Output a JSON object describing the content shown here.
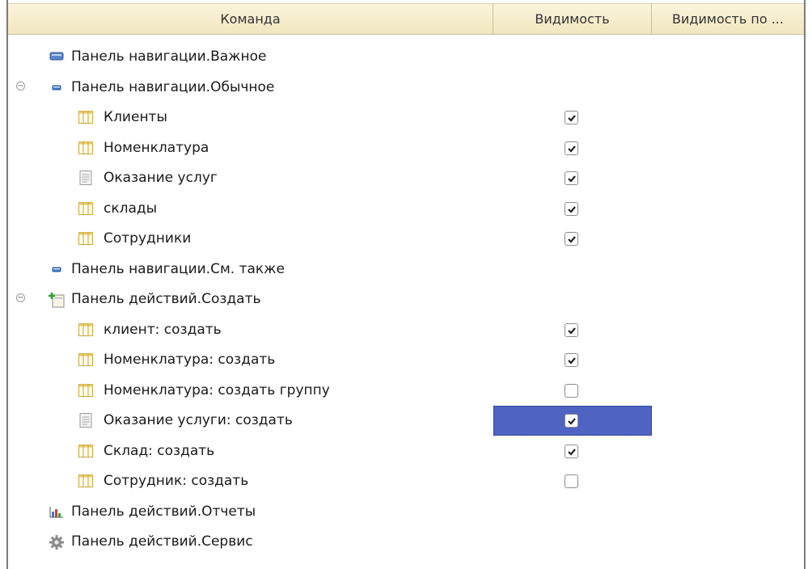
{
  "columns": {
    "command": "Команда",
    "visibility": "Видимость",
    "visibility_by": "Видимость по ..."
  },
  "rows": [
    {
      "label": "Панель навигации.Важное",
      "icon": "nav-panel-important-icon",
      "level": 0,
      "toggle": false,
      "checkbox": null
    },
    {
      "label": "Панель навигации.Обычное",
      "icon": "nav-panel-normal-icon",
      "level": 0,
      "toggle": true,
      "checkbox": null
    },
    {
      "label": "Клиенты",
      "icon": "catalog-icon",
      "level": 1,
      "toggle": false,
      "checkbox": true
    },
    {
      "label": "Номенклатура",
      "icon": "catalog-icon",
      "level": 1,
      "toggle": false,
      "checkbox": true
    },
    {
      "label": "Оказание услуг",
      "icon": "document-icon",
      "level": 1,
      "toggle": false,
      "checkbox": true
    },
    {
      "label": "склады",
      "icon": "catalog-icon",
      "level": 1,
      "toggle": false,
      "checkbox": true
    },
    {
      "label": "Сотрудники",
      "icon": "catalog-icon",
      "level": 1,
      "toggle": false,
      "checkbox": true
    },
    {
      "label": "Панель навигации.См. также",
      "icon": "nav-panel-see-also-icon",
      "level": 0,
      "toggle": false,
      "checkbox": null
    },
    {
      "label": "Панель действий.Создать",
      "icon": "create-document-icon",
      "level": 0,
      "toggle": true,
      "checkbox": null
    },
    {
      "label": "клиент: создать",
      "icon": "catalog-icon",
      "level": 1,
      "toggle": false,
      "checkbox": true
    },
    {
      "label": "Номенклатура: создать",
      "icon": "catalog-icon",
      "level": 1,
      "toggle": false,
      "checkbox": true
    },
    {
      "label": "Номенклатура: создать группу",
      "icon": "catalog-icon",
      "level": 1,
      "toggle": false,
      "checkbox": false
    },
    {
      "label": "Оказание услуги: создать",
      "icon": "document-icon",
      "level": 1,
      "toggle": false,
      "checkbox": true,
      "selected": true
    },
    {
      "label": "Склад: создать",
      "icon": "catalog-icon",
      "level": 1,
      "toggle": false,
      "checkbox": true
    },
    {
      "label": "Сотрудник: создать",
      "icon": "catalog-icon",
      "level": 1,
      "toggle": false,
      "checkbox": false
    },
    {
      "label": "Панель действий.Отчеты",
      "icon": "reports-chart-icon",
      "level": 0,
      "toggle": false,
      "checkbox": null
    },
    {
      "label": "Панель действий.Сервис",
      "icon": "service-gear-icon",
      "level": 0,
      "toggle": false,
      "checkbox": null
    }
  ],
  "colors": {
    "header_bg": "#f6eccb",
    "selection": "#4f63c3",
    "grid_line": "#c9bf9c"
  }
}
